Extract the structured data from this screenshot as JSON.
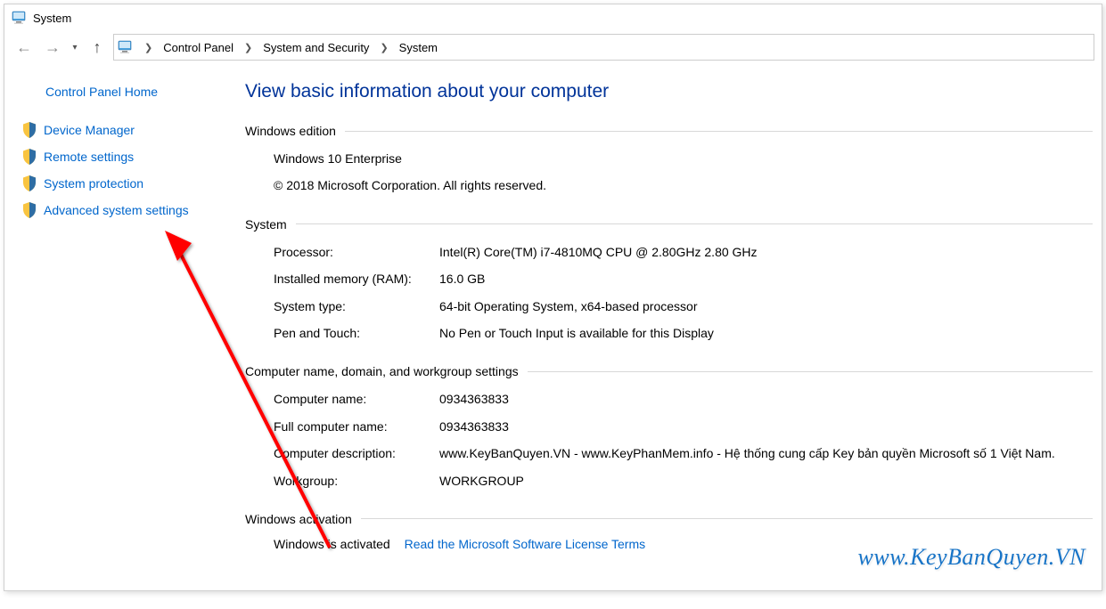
{
  "window": {
    "title": "System"
  },
  "breadcrumb": {
    "items": [
      "Control Panel",
      "System and Security",
      "System"
    ]
  },
  "sidebar": {
    "home": "Control Panel Home",
    "items": [
      "Device Manager",
      "Remote settings",
      "System protection",
      "Advanced system settings"
    ]
  },
  "main": {
    "heading": "View basic information about your computer",
    "edition": {
      "title": "Windows edition",
      "name": "Windows 10 Enterprise",
      "copyright": "© 2018 Microsoft Corporation. All rights reserved."
    },
    "system": {
      "title": "System",
      "rows": {
        "processor_k": "Processor:",
        "processor_v": "Intel(R) Core(TM) i7-4810MQ CPU @ 2.80GHz   2.80 GHz",
        "ram_k": "Installed memory (RAM):",
        "ram_v": "16.0 GB",
        "type_k": "System type:",
        "type_v": "64-bit Operating System, x64-based processor",
        "pen_k": "Pen and Touch:",
        "pen_v": "No Pen or Touch Input is available for this Display"
      }
    },
    "computer": {
      "title": "Computer name, domain, and workgroup settings",
      "rows": {
        "name_k": "Computer name:",
        "name_v": "0934363833",
        "full_k": "Full computer name:",
        "full_v": "0934363833",
        "desc_k": "Computer description:",
        "desc_v": "www.KeyBanQuyen.VN - www.KeyPhanMem.info - Hệ thống cung cấp Key bản quyền Microsoft số 1 Việt Nam.",
        "wg_k": "Workgroup:",
        "wg_v": "WORKGROUP"
      }
    },
    "activation": {
      "title": "Windows activation",
      "status": "Windows is activated",
      "link": "Read the Microsoft Software License Terms"
    }
  },
  "watermark": "www.KeyBanQuyen.VN"
}
